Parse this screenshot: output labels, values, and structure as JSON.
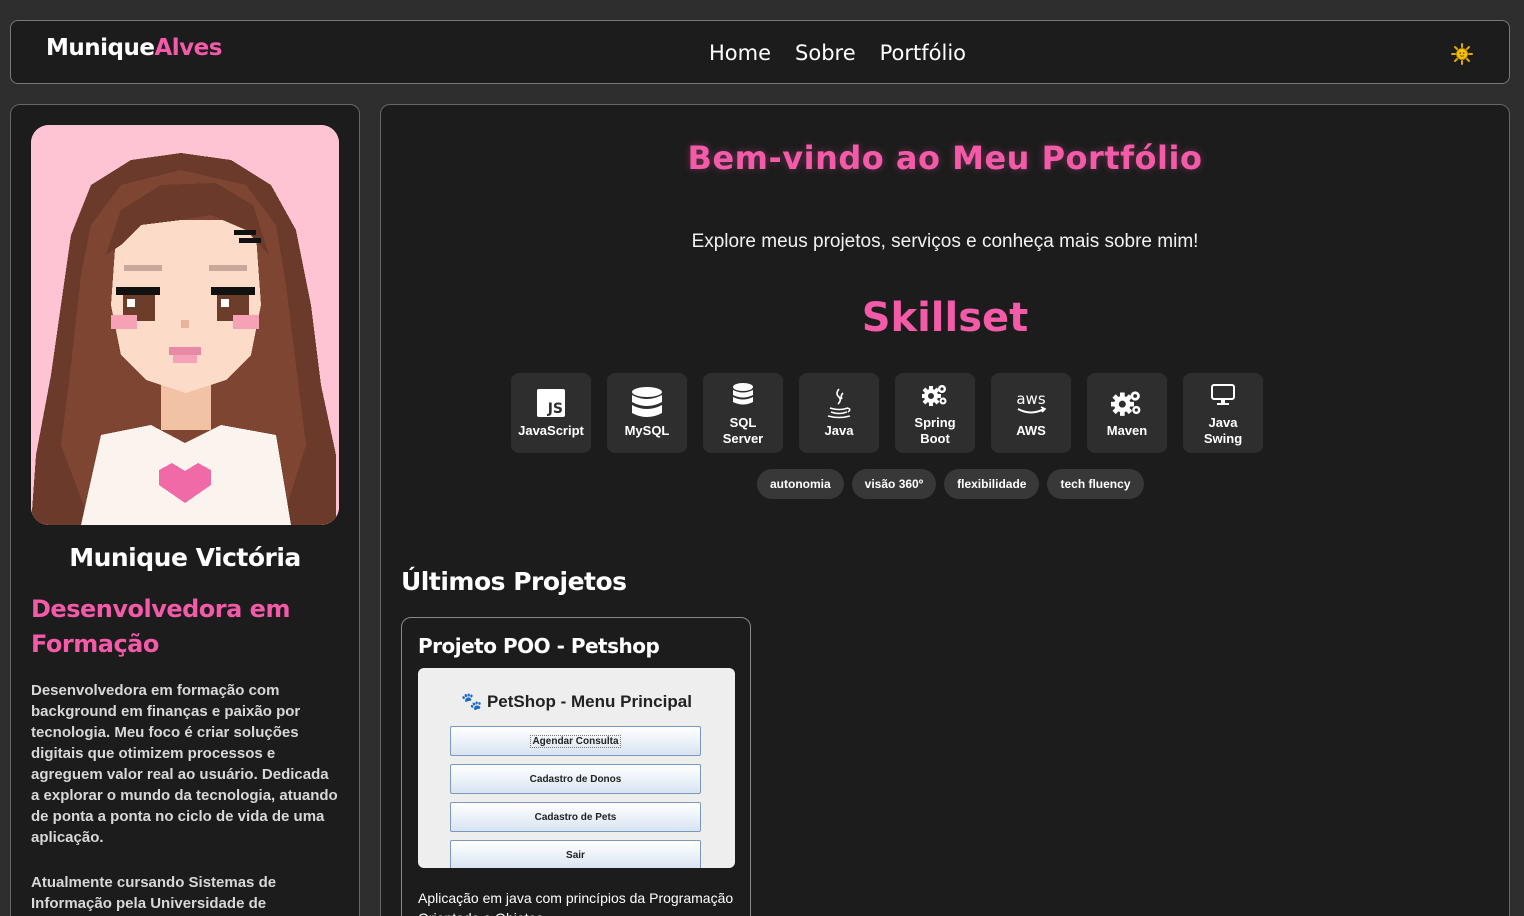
{
  "navbar": {
    "logo_first": "Munique",
    "logo_last": "Alves",
    "links": [
      "Home",
      "Sobre",
      "Portfólio"
    ],
    "theme_icon": "sun-icon"
  },
  "profile": {
    "name": "Munique Victória",
    "role": "Desenvolvedora em Formação",
    "bio": "Desenvolvedora em formação com background em finanças e paixão por tecnologia. Meu foco é criar soluções digitais que otimizem processos e agreguem valor real ao usuário. Dedicada a explorar o mundo da tecnologia, atuando de ponta a ponta no ciclo de vida de uma aplicação.",
    "study": "Atualmente cursando Sistemas de Informação pela Universidade de"
  },
  "hero": {
    "title": "Bem-vindo ao Meu Portfólio",
    "subtitle": "Explore meus projetos, serviços e conheça mais sobre mim!"
  },
  "skillset": {
    "title": "Skillset",
    "skills": [
      {
        "label": "JavaScript",
        "icon": "js-icon"
      },
      {
        "label": "MySQL",
        "icon": "database-icon"
      },
      {
        "label": "SQL Server",
        "icon": "database-stack-icon"
      },
      {
        "label": "Java",
        "icon": "java-icon"
      },
      {
        "label": "Spring Boot",
        "icon": "gears-icon"
      },
      {
        "label": "AWS",
        "icon": "aws-icon"
      },
      {
        "label": "Maven",
        "icon": "gears-icon"
      },
      {
        "label": "Java Swing",
        "icon": "monitor-icon"
      }
    ],
    "soft_skills": [
      "autonomia",
      "visão 360º",
      "flexibilidade",
      "tech fluency"
    ]
  },
  "projects": {
    "title": "Últimos Projetos",
    "items": [
      {
        "title": "Projeto POO - Petshop",
        "screenshot": {
          "header": "🐾 PetShop - Menu Principal",
          "buttons": [
            "Agendar Consulta",
            "Cadastro de Donos",
            "Cadastro de Pets",
            "Sair"
          ]
        },
        "description": "Aplicação em java com princípios da Programação Orientada a Objetos"
      }
    ]
  },
  "colors": {
    "accent": "#f35aa8",
    "background": "#2e2e2e",
    "panel": "#1c1c1c"
  }
}
